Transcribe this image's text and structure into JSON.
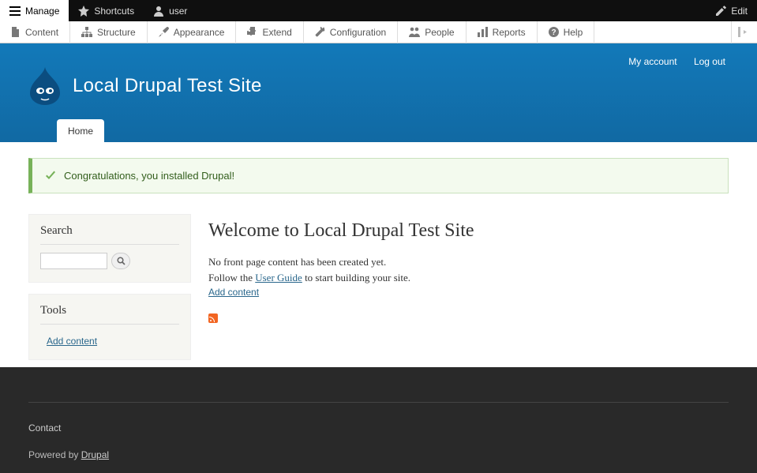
{
  "toolbar_top": {
    "manage": "Manage",
    "shortcuts": "Shortcuts",
    "user": "user",
    "edit": "Edit"
  },
  "toolbar_admin": {
    "content": "Content",
    "structure": "Structure",
    "appearance": "Appearance",
    "extend": "Extend",
    "configuration": "Configuration",
    "people": "People",
    "reports": "Reports",
    "help": "Help"
  },
  "header": {
    "my_account": "My account",
    "log_out": "Log out",
    "site_name": "Local Drupal Test Site",
    "home_tab": "Home"
  },
  "status": {
    "message": "Congratulations, you installed Drupal!"
  },
  "sidebar": {
    "search_title": "Search",
    "search_value": "",
    "tools_title": "Tools",
    "add_content": "Add content"
  },
  "main": {
    "title": "Welcome to Local Drupal Test Site",
    "no_front": "No front page content has been created yet.",
    "follow_pre": "Follow the ",
    "user_guide": "User Guide",
    "follow_post": " to start building your site.",
    "add_content": "Add content"
  },
  "footer": {
    "contact": "Contact",
    "powered_by": "Powered by ",
    "drupal": "Drupal"
  }
}
